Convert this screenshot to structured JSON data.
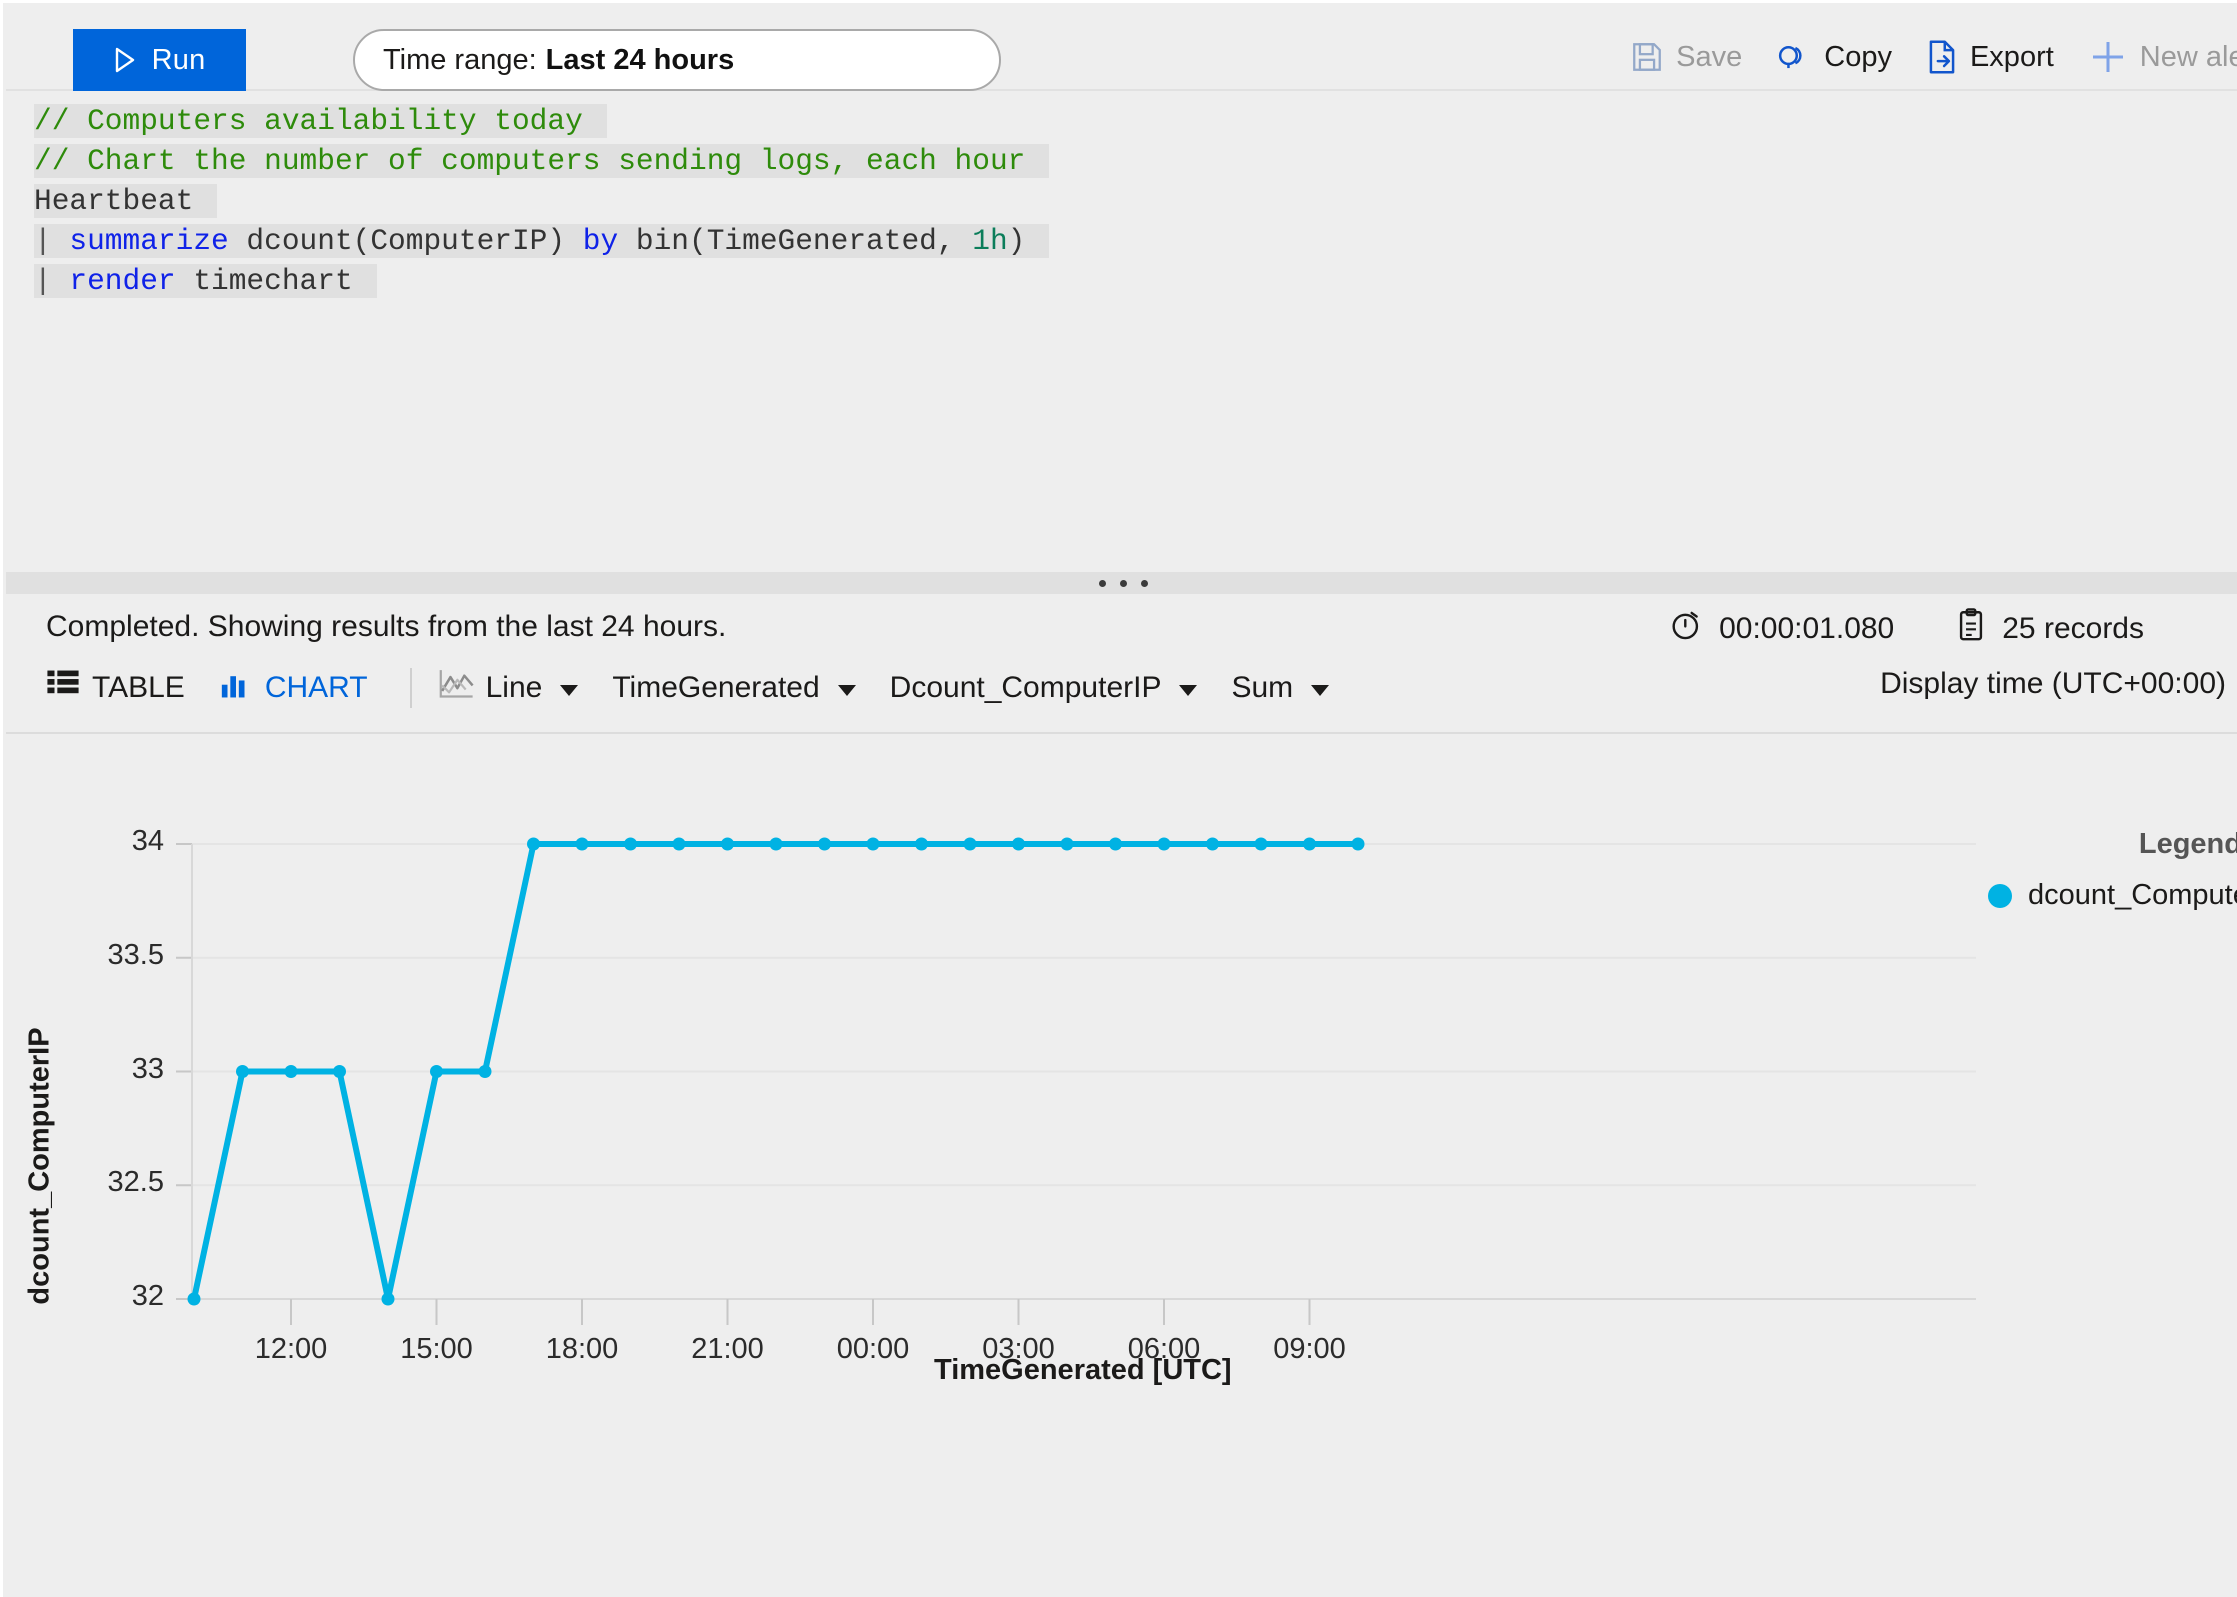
{
  "toolbar": {
    "run_label": "Run",
    "run_icon": "play-icon",
    "time_range_label": "Time range:",
    "time_range_value": "Last 24 hours",
    "actions": [
      {
        "label": "Save",
        "icon": "save-icon",
        "enabled": false
      },
      {
        "label": "Copy",
        "icon": "link-copy-icon",
        "enabled": true
      },
      {
        "label": "Export",
        "icon": "export-icon",
        "enabled": true
      },
      {
        "label": "New alert r",
        "icon": "plus-icon",
        "enabled": false
      }
    ]
  },
  "editor": {
    "lines": [
      {
        "segments": [
          {
            "text": "// Computers availability today",
            "type": "comment"
          }
        ]
      },
      {
        "segments": [
          {
            "text": "// Chart the number of computers sending logs, each hour",
            "type": "comment"
          }
        ]
      },
      {
        "segments": [
          {
            "text": "Heartbeat",
            "type": "ident"
          }
        ]
      },
      {
        "segments": [
          {
            "text": "| ",
            "type": "pipe"
          },
          {
            "text": "summarize",
            "type": "kw"
          },
          {
            "text": " dcount(ComputerIP) ",
            "type": "ident"
          },
          {
            "text": "by",
            "type": "kw"
          },
          {
            "text": " bin(TimeGenerated, ",
            "type": "ident"
          },
          {
            "text": "1h",
            "type": "num"
          },
          {
            "text": ")",
            "type": "ident"
          }
        ]
      },
      {
        "segments": [
          {
            "text": "| ",
            "type": "pipe"
          },
          {
            "text": "render",
            "type": "kw"
          },
          {
            "text": " timechart",
            "type": "ident"
          }
        ]
      }
    ]
  },
  "results": {
    "status": "Completed. Showing results from the last 24 hours.",
    "duration": "00:00:01.080",
    "duration_icon": "timer-icon",
    "records": "25 records",
    "records_icon": "clipboard-icon",
    "display_time": "Display time (UTC+00:00)",
    "view_tabs": [
      {
        "label": "TABLE",
        "icon": "table-icon",
        "active": false
      },
      {
        "label": "CHART",
        "icon": "bar-chart-icon",
        "active": true
      }
    ],
    "controls": [
      {
        "label": "Line",
        "icon": "line-chart-icon",
        "has_chevron": true
      },
      {
        "label": "TimeGenerated",
        "icon": null,
        "has_chevron": true
      },
      {
        "label": "Dcount_ComputerIP",
        "icon": null,
        "has_chevron": true
      },
      {
        "label": "Sum",
        "icon": null,
        "has_chevron": true
      }
    ]
  },
  "chart_data": {
    "type": "line",
    "title": "",
    "xlabel": "TimeGenerated [UTC]",
    "ylabel": "dcount_ComputerIP",
    "legend_title": "Legend",
    "legend_position": "right",
    "grid": true,
    "series_color": "#00b2e3",
    "ylim": [
      32,
      34
    ],
    "yticks": [
      32,
      32.5,
      33,
      33.5,
      34
    ],
    "ytick_labels": [
      "32",
      "32.5",
      "33",
      "33.5",
      "34"
    ],
    "xticks": [
      "12:00",
      "15:00",
      "18:00",
      "21:00",
      "00:00",
      "03:00",
      "06:00",
      "09:00"
    ],
    "xlim_hours": [
      10,
      34
    ],
    "series": [
      {
        "name": "dcount_ComputerIP",
        "x": [
          "10:00",
          "11:00",
          "12:00",
          "13:00",
          "14:00",
          "15:00",
          "16:00",
          "17:00",
          "18:00",
          "19:00",
          "20:00",
          "21:00",
          "22:00",
          "23:00",
          "00:00",
          "01:00",
          "02:00",
          "03:00",
          "04:00",
          "05:00",
          "06:00",
          "07:00",
          "08:00",
          "09:00",
          "10:00"
        ],
        "values": [
          32,
          33,
          33,
          33,
          32,
          33,
          33,
          34,
          34,
          34,
          34,
          34,
          34,
          34,
          34,
          34,
          34,
          34,
          34,
          34,
          34,
          34,
          34,
          34,
          34
        ]
      }
    ]
  }
}
